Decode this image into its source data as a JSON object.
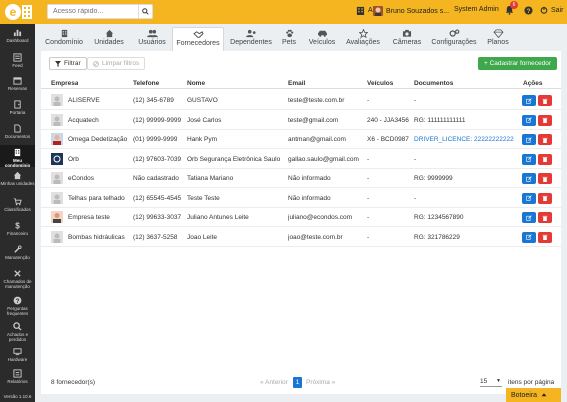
{
  "topbar": {
    "search_placeholder": "Acesso rápido...",
    "condo_name": "Alfa",
    "user_name": "Bruno Souzados s...",
    "role": "System Admin",
    "notif_count": "6",
    "logout_label": "Sair"
  },
  "sidebar": {
    "items": [
      {
        "label": "Dashboard",
        "icon": "dashboard-icon"
      },
      {
        "label": "Feed",
        "icon": "feed-icon"
      },
      {
        "label": "Reservas",
        "icon": "calendar-icon"
      },
      {
        "label": "Portaria",
        "icon": "gate-icon"
      },
      {
        "label": "Documentos",
        "icon": "documents-icon"
      },
      {
        "label": "Meu condomínio",
        "icon": "building-icon"
      },
      {
        "label": "Minhas unidades",
        "icon": "home-icon"
      },
      {
        "label": "Classificados",
        "icon": "cart-icon"
      },
      {
        "label": "Financeiro",
        "icon": "dollar-icon"
      },
      {
        "label": "Manutenção",
        "icon": "wrench-icon"
      },
      {
        "label": "Chamados de manutenção",
        "icon": "tools-icon"
      },
      {
        "label": "Perguntas frequentes",
        "icon": "question-icon"
      },
      {
        "label": "Achados e perdidos",
        "icon": "search-icon"
      },
      {
        "label": "Hardware",
        "icon": "hardware-icon"
      },
      {
        "label": "Relatórios",
        "icon": "reports-icon"
      },
      {
        "label": "Versão 1.10.6",
        "icon": ""
      }
    ]
  },
  "tabs": [
    {
      "label": "Condomínio",
      "icon": "building-icon"
    },
    {
      "label": "Unidades",
      "icon": "home-icon"
    },
    {
      "label": "Usuários",
      "icon": "users-icon"
    },
    {
      "label": "Fornecedores",
      "icon": "handshake-icon"
    },
    {
      "label": "Dependentes",
      "icon": "dependents-icon"
    },
    {
      "label": "Pets",
      "icon": "paw-icon"
    },
    {
      "label": "Veículos",
      "icon": "car-icon"
    },
    {
      "label": "Avaliações",
      "icon": "star-icon"
    },
    {
      "label": "Câmeras",
      "icon": "camera-icon"
    },
    {
      "label": "Configurações",
      "icon": "gears-icon"
    },
    {
      "label": "Planos",
      "icon": "diamond-icon"
    }
  ],
  "toolbar": {
    "filter_label": "Filtrar",
    "clear_label": "Limpar filtros",
    "add_label": "+ Cadastrar fornecedor"
  },
  "table": {
    "headers": [
      "Empresa",
      "Telefone",
      "Nome",
      "Email",
      "Veículos",
      "Documentos",
      "Ações"
    ],
    "rows": [
      {
        "empresa": "ALISERVE",
        "telefone": "(12) 345-6789",
        "nome": "GUSTAVO",
        "email": "teste@teste.com.br",
        "veiculos": "-",
        "documentos": "-",
        "doc_link": false
      },
      {
        "empresa": "Acquatech",
        "telefone": "(12) 99999-9999",
        "nome": "José Carlos",
        "email": "teste@gmail.com",
        "veiculos": "240 - JJA3456",
        "documentos": "RG: 111111111111",
        "doc_link": false
      },
      {
        "empresa": "Ômega Dedetização",
        "telefone": "(01) 9999-9999",
        "nome": "Hank Pym",
        "email": "antman@gmail.com",
        "veiculos": "X6 - BCD0987",
        "documentos": "DRIVER_LICENCE: 22222222222",
        "doc_link": true
      },
      {
        "empresa": "Orb",
        "telefone": "(12) 97603-7039",
        "nome": "Orb Segurança Eletrônica Saulo",
        "email": "gallao.saulo@gmail.com",
        "veiculos": "-",
        "documentos": "-",
        "doc_link": false
      },
      {
        "empresa": "eCondos",
        "telefone": "Não cadastrado",
        "nome": "Tatiana Mariano",
        "email": "Não informado",
        "veiculos": "-",
        "documentos": "RG: 9999999",
        "doc_link": false
      },
      {
        "empresa": "Telhas para telhado",
        "telefone": "(12) 65545-4545",
        "nome": "Teste Teste",
        "email": "Não informado",
        "veiculos": "-",
        "documentos": "-",
        "doc_link": false
      },
      {
        "empresa": "Empresa teste",
        "telefone": "(12) 99633-3037",
        "nome": "Juliano Antunes Leite",
        "email": "juliano@econdos.com",
        "veiculos": "-",
        "documentos": "RG: 1234567890",
        "doc_link": false
      },
      {
        "empresa": "Bombas hidráulicas",
        "telefone": "(12) 3637-5258",
        "nome": "Joao Leite",
        "email": "joao@teste.com.br",
        "veiculos": "-",
        "documentos": "RG: 321786229",
        "doc_link": false
      }
    ]
  },
  "footer": {
    "count": "8 fornecedor(s)",
    "prev": "« Anterior",
    "page": "1",
    "next": "Próxima »",
    "per_page_value": "15",
    "per_page_label": "itens por página"
  },
  "botoeira_label": "Botoeira",
  "colors": {
    "brand": "#f4b521",
    "sidebar": "#2b2b2b",
    "add": "#3fa84d",
    "edit": "#1976d2",
    "delete": "#e53935"
  }
}
